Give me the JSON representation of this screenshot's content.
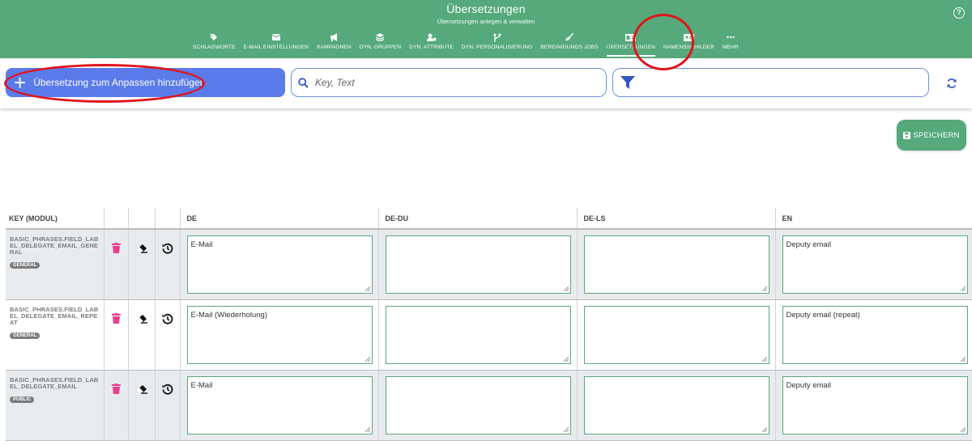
{
  "header": {
    "title": "Übersetzungen",
    "subtitle": "Übersetzungen anlegen & verwalten",
    "help_icon": "question-circle-icon",
    "nav": [
      {
        "label": "SCHLAGWORTE",
        "icon": "tag-icon"
      },
      {
        "label": "E-MAIL EINSTELLUNGEN",
        "icon": "envelope-icon"
      },
      {
        "label": "KAMPAGNEN",
        "icon": "megaphone-icon"
      },
      {
        "label": "DYN. GRUPPEN",
        "icon": "layers-icon"
      },
      {
        "label": "DYN. ATTRIBUTE",
        "icon": "user-cog-icon"
      },
      {
        "label": "DYN. PERSONALISIERUNG",
        "icon": "branch-icon"
      },
      {
        "label": "BEREINIGUNGS JOBS",
        "icon": "broom-icon"
      },
      {
        "label": "ÜBERSETZUNGEN",
        "icon": "language-icon"
      },
      {
        "label": "NAMENSSCHILDER",
        "icon": "id-card-icon"
      },
      {
        "label": "MEHR",
        "icon": "more-icon"
      }
    ]
  },
  "toolbar": {
    "add_label": "Übersetzung zum Anpassen hinzufügen",
    "search_placeholder": "Key, Text",
    "save_label": "SPEICHERN"
  },
  "table": {
    "headers": [
      "KEY (MODUL)",
      "",
      "",
      "",
      "DE",
      "DE-DU",
      "DE-LS",
      "EN"
    ],
    "rows": [
      {
        "key": "BASIC_PHRASES.FIELD_LABEL_DELEGATE_EMAIL_GENERAL",
        "module": "GENERAL",
        "de": "E-Mail",
        "de_du": "",
        "de_ls": "",
        "en": "Deputy email"
      },
      {
        "key": "BASIC_PHRASES.FIELD_LABEL_DELEGATE_EMAIL_REPEAT",
        "module": "GENERAL",
        "de": "E-Mail (Wiederholung)",
        "de_du": "",
        "de_ls": "",
        "en": "Deputy email (repeat)"
      },
      {
        "key": "BASIC_PHRASES.FIELD_LABEL_DELEGATE_EMAIL",
        "module": "PUBLIC",
        "de": "E-Mail",
        "de_du": "",
        "de_ls": "",
        "en": "Deputy email"
      }
    ]
  },
  "colors": {
    "header_green": "#55a97a",
    "accent_blue": "#5b7bea",
    "delete_pink": "#e83e8c",
    "annotation_red": "#e0141c"
  }
}
